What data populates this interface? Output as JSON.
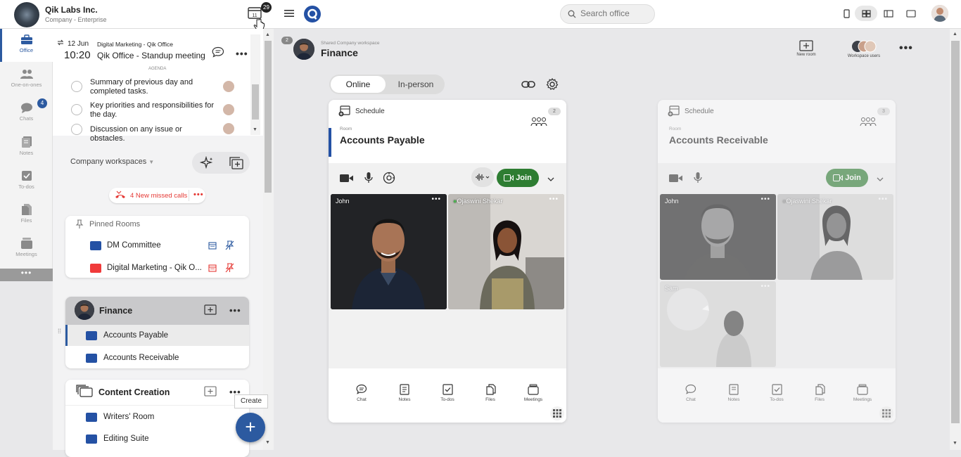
{
  "header": {
    "company_name": "Qik Labs Inc.",
    "company_plan": "Company - Enterprise",
    "calendar_day": "11",
    "notification_count": "29",
    "search_placeholder": "Search office"
  },
  "rail": {
    "items": [
      {
        "label": "Office",
        "icon": "briefcase-icon"
      },
      {
        "label": "One-on-ones",
        "icon": "people-icon"
      },
      {
        "label": "Chats",
        "icon": "chat-icon"
      },
      {
        "label": "Notes",
        "icon": "notes-icon"
      },
      {
        "label": "To-dos",
        "icon": "todo-icon"
      },
      {
        "label": "Files",
        "icon": "files-icon"
      },
      {
        "label": "Meetings",
        "icon": "meetings-icon"
      }
    ],
    "chat_badge": "4",
    "more": "•••"
  },
  "meeting": {
    "date": "12 Jun",
    "time": "10:20",
    "org": "Digital Marketing - Qik Office",
    "title": "Qik Office - Standup meeting",
    "agenda_label": "AGENDA",
    "agenda": [
      "Summary of previous day and completed tasks.",
      "Key priorities and responsibilities for the day.",
      "Discussion on any issue or obstacles."
    ]
  },
  "sidebar": {
    "workspaces_label": "Company workspaces",
    "missed_calls": "4 New missed calls",
    "pinned_title": "Pinned Rooms",
    "pinned": [
      {
        "name": "DM Committee",
        "color": "#2451a4"
      },
      {
        "name": "Digital Marketing - Qik O...",
        "color": "#f03a3a"
      }
    ],
    "finance": {
      "name": "Finance",
      "rooms": [
        "Accounts Payable",
        "Accounts Receivable"
      ]
    },
    "content": {
      "name": "Content Creation",
      "rooms": [
        "Writers' Room",
        "Editing Suite"
      ]
    },
    "create_tooltip": "Create",
    "fab": "+"
  },
  "workspace": {
    "badge": "2",
    "subtitle": "Shared Company workspace",
    "title": "Finance",
    "new_room": "New room",
    "workspace_users": "Workspace users",
    "mode_online": "Online",
    "mode_inperson": "In-person"
  },
  "rooms": [
    {
      "schedule": "Schedule",
      "count": "2",
      "label": "Room",
      "name": "Accounts Payable",
      "join": "Join",
      "participants": [
        "John",
        "Ojaswini Shekar"
      ],
      "bottom": [
        "Chat",
        "Notes",
        "To-dos",
        "Files",
        "Meetings"
      ]
    },
    {
      "schedule": "Schedule",
      "count": "3",
      "label": "Room",
      "name": "Accounts Receivable",
      "join": "Join",
      "participants": [
        "John",
        "Ojaswini Shekar",
        "Sam"
      ],
      "bottom": [
        "Chat",
        "Notes",
        "To-dos",
        "Files",
        "Meetings"
      ]
    }
  ],
  "colors": {
    "accent": "#2c5aa0",
    "join": "#2e7d32",
    "missed": "#e53935"
  }
}
